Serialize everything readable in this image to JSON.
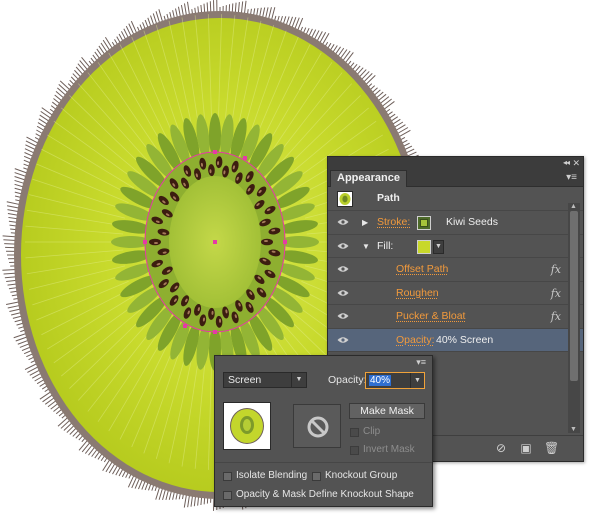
{
  "appearance_panel": {
    "tab_title": "Appearance",
    "object_label": "Path",
    "rows": [
      {
        "label": "Stroke:",
        "value": "Kiwi Seeds"
      },
      {
        "label": "Fill:"
      },
      {
        "label": "Offset Path",
        "fx": "fx"
      },
      {
        "label": "Roughen",
        "fx": "fx"
      },
      {
        "label": "Pucker & Bloat",
        "fx": "fx"
      },
      {
        "label": "Opacity:",
        "value": "40% Screen"
      }
    ],
    "fill_color": "#c8d82a",
    "accent_color": "#f29a3c",
    "selected_row_color": "#56657b"
  },
  "transparency_panel": {
    "blend_mode": "Screen",
    "opacity_label": "Opacity:",
    "opacity_value": "40%",
    "make_mask_label": "Make Mask",
    "clip_label": "Clip",
    "invert_mask_label": "Invert Mask",
    "isolate_blending_label": "Isolate Blending",
    "knockout_group_label": "Knockout Group",
    "opacity_mask_label": "Opacity & Mask Define Knockout Shape"
  },
  "artwork": {
    "flesh_color": "#c6d92b",
    "core_color": "#b6cd35",
    "seed_color": "#3c1d10",
    "skin_color": "#6e5f5a",
    "anchor_color": "#e63aa6"
  }
}
